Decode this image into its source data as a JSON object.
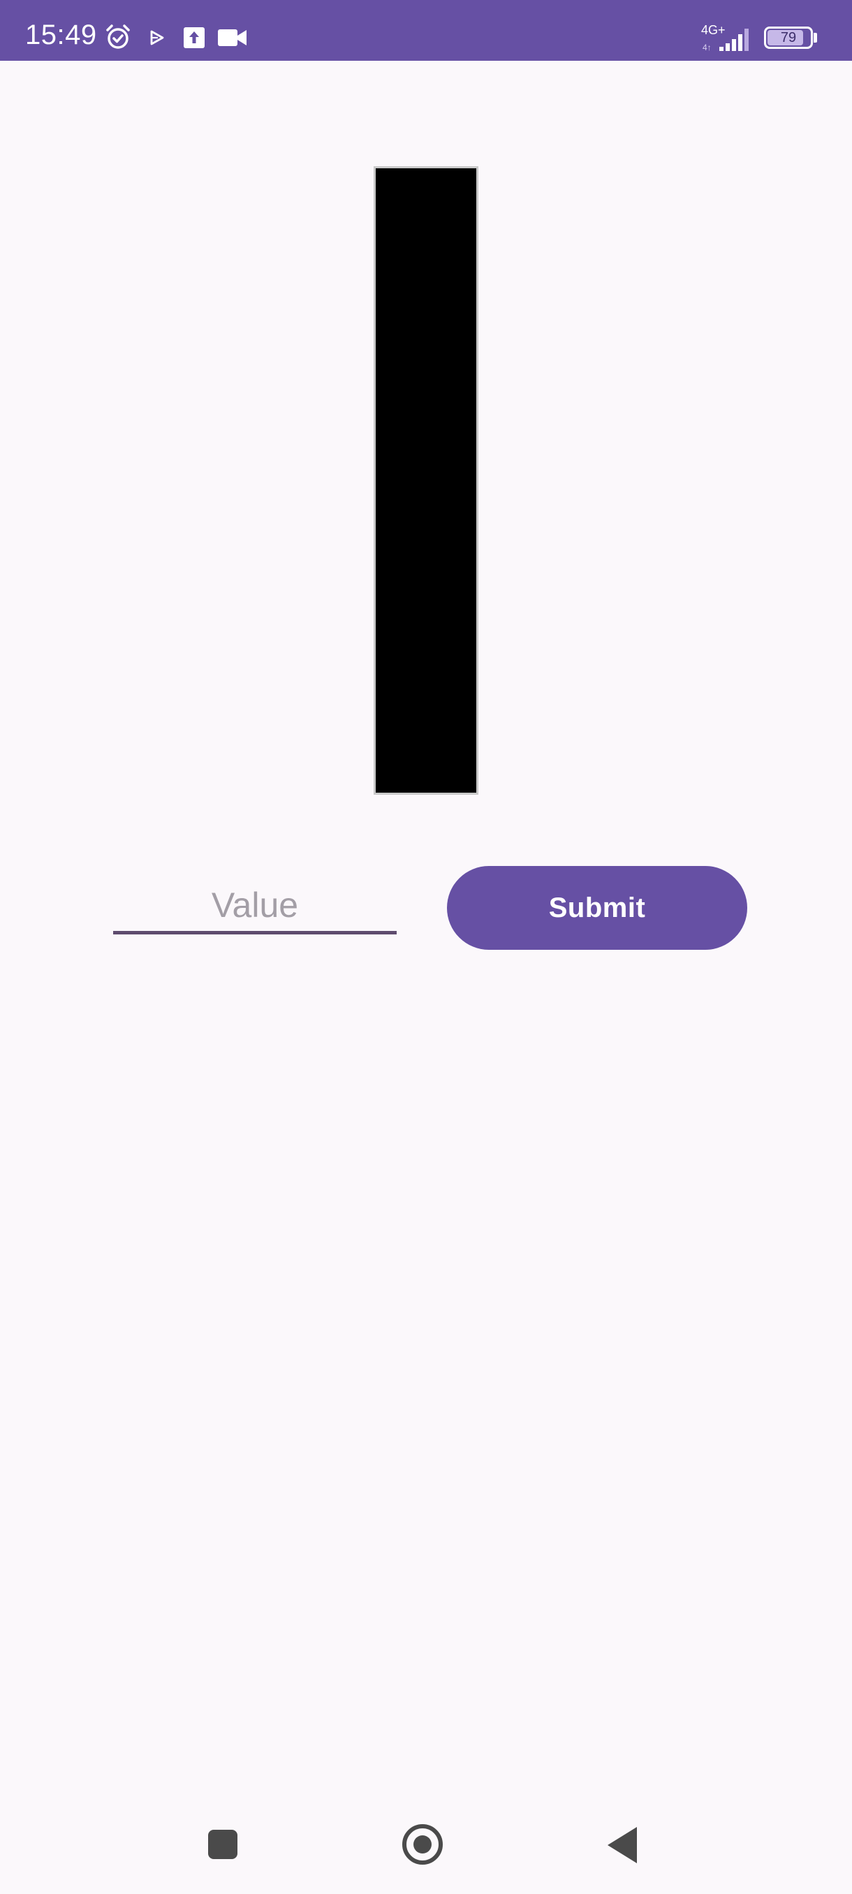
{
  "status_bar": {
    "time": "15:49",
    "network": "4G+",
    "battery_level": "79",
    "background_color": "#6650a4",
    "icons": [
      "alarm-icon",
      "play-store-icon",
      "upload-icon",
      "video-camera-icon",
      "signal-icon",
      "battery-icon"
    ]
  },
  "bar": {
    "fill_fraction": 1.0,
    "fill_color": "#000000",
    "border_color": "#c9c9c9"
  },
  "form": {
    "value_placeholder": "Value",
    "value_text": "",
    "submit_label": "Submit",
    "accent_color": "#6650a4"
  },
  "nav_bar": {
    "icons": [
      "recents-icon",
      "home-icon",
      "back-icon"
    ]
  }
}
